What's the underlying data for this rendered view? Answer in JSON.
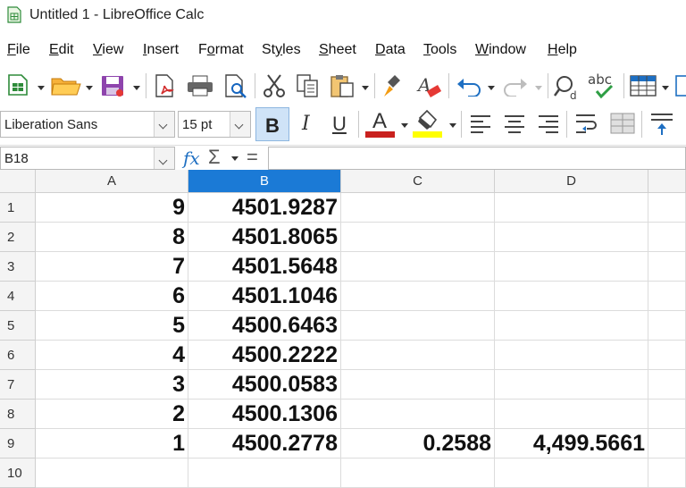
{
  "window": {
    "title": "Untitled 1 - LibreOffice Calc"
  },
  "menu": [
    "File",
    "Edit",
    "View",
    "Insert",
    "Format",
    "Styles",
    "Sheet",
    "Data",
    "Tools",
    "Window",
    "Help"
  ],
  "menu_mnemonic_index": [
    0,
    0,
    0,
    0,
    1,
    2,
    0,
    0,
    0,
    0,
    0
  ],
  "format_bar": {
    "font_name": "Liberation Sans",
    "font_size": "15 pt",
    "bold": "B",
    "italic": "I",
    "underline": "U",
    "font_color": "#c9211e",
    "highlight_color": "#ffff00"
  },
  "formula_bar": {
    "name_box": "B18",
    "fx": "fx",
    "sigma": "Σ",
    "equals": "=",
    "formula": ""
  },
  "sheet": {
    "columns": [
      "A",
      "B",
      "C",
      "D"
    ],
    "selected_column": "B",
    "rows": [
      {
        "n": "1",
        "A": "9",
        "B": "4501.9287",
        "C": "",
        "D": ""
      },
      {
        "n": "2",
        "A": "8",
        "B": "4501.8065",
        "C": "",
        "D": ""
      },
      {
        "n": "3",
        "A": "7",
        "B": "4501.5648",
        "C": "",
        "D": ""
      },
      {
        "n": "4",
        "A": "6",
        "B": "4501.1046",
        "C": "",
        "D": ""
      },
      {
        "n": "5",
        "A": "5",
        "B": "4500.6463",
        "C": "",
        "D": ""
      },
      {
        "n": "6",
        "A": "4",
        "B": "4500.2222",
        "C": "",
        "D": ""
      },
      {
        "n": "7",
        "A": "3",
        "B": "4500.0583",
        "C": "",
        "D": ""
      },
      {
        "n": "8",
        "A": "2",
        "B": "4500.1306",
        "C": "",
        "D": ""
      },
      {
        "n": "9",
        "A": "1",
        "B": "4500.2778",
        "C": "0.2588",
        "D": "4,499.5661"
      },
      {
        "n": "10",
        "A": "",
        "B": "",
        "C": "",
        "D": ""
      }
    ]
  },
  "toolbar_icons": [
    "new-spreadsheet-icon",
    "open-folder-icon",
    "save-icon",
    "export-pdf-icon",
    "print-icon",
    "print-preview-icon",
    "cut-icon",
    "copy-icon",
    "paste-icon",
    "clone-formatting-icon",
    "clear-formatting-icon",
    "undo-icon",
    "redo-icon",
    "find-replace-icon",
    "spelling-icon",
    "row-column-icon"
  ]
}
